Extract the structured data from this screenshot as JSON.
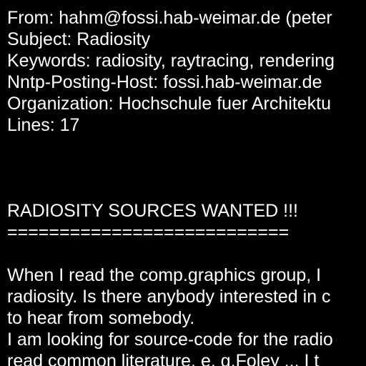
{
  "colors": {
    "background": "#000000",
    "text": "#ffffff"
  },
  "header": {
    "from": "From: hahm@fossi.hab-weimar.de (peter",
    "subject": "Subject: Radiosity",
    "keywords": "Keywords: radiosity, raytracing, rendering",
    "nntp_host": "Nntp-Posting-Host: fossi.hab-weimar.de",
    "organization": "Organization: Hochschule fuer Architektu",
    "lines": "Lines: 17"
  },
  "body": {
    "heading": "RADIOSITY SOURCES WANTED !!!",
    "underline": "===========================",
    "paragraph": [
      "When I read the comp.graphics group, I",
      "radiosity. Is there anybody interested in c",
      "to hear from somebody.",
      "I am looking for source-code for the radio",
      "read common literature, e. g.Foley ... I t"
    ]
  }
}
